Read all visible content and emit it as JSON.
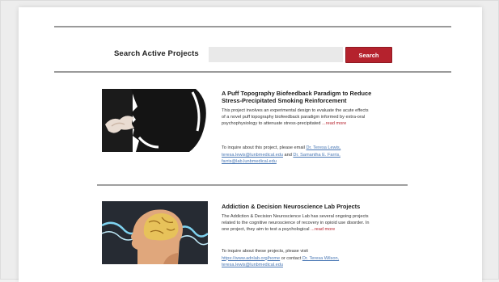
{
  "search": {
    "label": "Search Active Projects",
    "placeholder": "",
    "value": "",
    "button_label": "Search"
  },
  "projects": [
    {
      "title_line1": "A Puff Topography Biofeedback Paradigm to Reduce",
      "title_line2": "Stress-Precipitated Smoking Reinforcement",
      "desc_lines": [
        "This project involves an experimental design to evaluate the acute effects",
        "of a novel puff topography biofeedback paradigm informed by extra-oral",
        "psychophysiology to attenuate stress-precipitated"
      ],
      "read_more": "...read more",
      "contact_line1": "To inquire about this project, please email",
      "contact_name1": "Dr. Teresa Lewis,",
      "contact_email1": "teresa.lewis@lunbmedical.edu",
      "contact_and": "and",
      "contact_name2": "Dr. Samantha E. Farris,",
      "contact_email2": "farris@lab.lunbmedical.edu"
    },
    {
      "title_line1": "Addiction & Decision Neuroscience Lab Projects",
      "desc_lines": [
        "The Addiction & Decision Neuroscience Lab has several ongoing projects",
        "related to the cognitive neuroscience of recovery in opioid use disorder. In",
        "one project, they aim to test a psychological"
      ],
      "read_more": "...read more",
      "contact_line1": "To inquire about these projects, please visit",
      "contact_link1": "https://www.adnlab.org/home",
      "contact_or": "or contact",
      "contact_name1": "Dr. Teresa Wilson,",
      "contact_email1": "teresa.lewis@lunbmedical.edu"
    }
  ],
  "colors": {
    "accent": "#b5222d",
    "link": "#4a78b5",
    "rule": "#9a9a9a"
  }
}
